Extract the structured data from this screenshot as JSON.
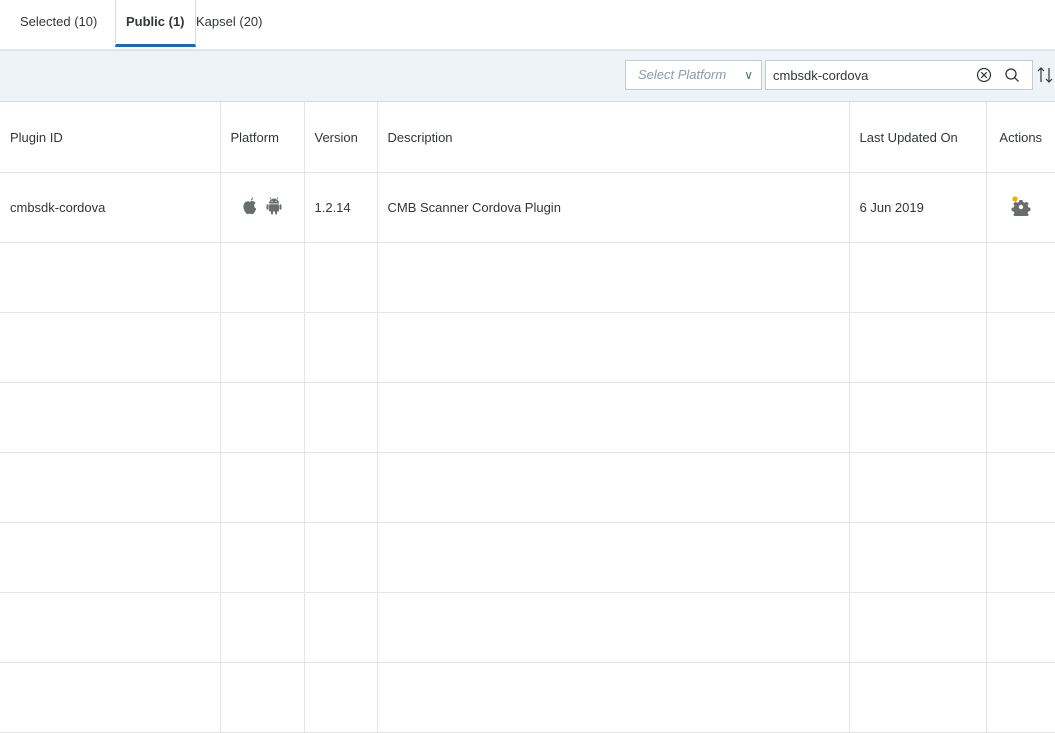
{
  "tabs": [
    {
      "label": "Selected (10)"
    },
    {
      "label": "Public (1)"
    },
    {
      "label": "Kapsel (20)"
    }
  ],
  "toolbar": {
    "platform_select": {
      "placeholder": "Select Platform"
    },
    "search": {
      "value": "cmbsdk-cordova"
    }
  },
  "table": {
    "columns": [
      "Plugin ID",
      "Platform",
      "Version",
      "Description",
      "Last Updated On",
      "Actions"
    ],
    "rows": [
      {
        "plugin_id": "cmbsdk-cordova",
        "platforms": [
          "apple-icon",
          "android-icon"
        ],
        "version": "1.2.14",
        "description": "CMB Scanner Cordova Plugin",
        "last_updated": "6 Jun 2019",
        "action_icon": "gear-settings-icon"
      }
    ]
  },
  "colors": {
    "accent": "#0a6ed1",
    "toolbar_bg": "#eef3f9",
    "icon_gray": "#6a6d70"
  }
}
